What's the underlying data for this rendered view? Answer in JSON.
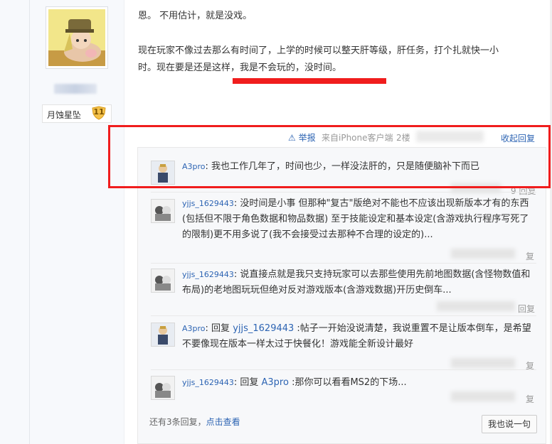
{
  "author": {
    "badge_name": "月蚀星坠",
    "badge_level": "11"
  },
  "post": {
    "line1": "恩。 不用估计，就是没戏。",
    "line2a": "现在玩家不像过去那么有时间了，上学的时候可以整天肝等级，肝任务，打个扎就快一小",
    "line2b": "时。现在要是还是这样，我是不会玩的，没时间。"
  },
  "meta": {
    "report": "举报",
    "from_device": "来自iPhone客户端",
    "floor": "2楼",
    "collapse": "收起回复"
  },
  "replies": [
    {
      "user": "A3pro",
      "sep": ": ",
      "text": "我也工作几年了，时间也少，一样没法肝的，只是随便脑补下而已",
      "foot": "9 回复"
    },
    {
      "user": "yjjs_1629443",
      "sep": ": ",
      "text": "没时间是小事 但那种\"复古\"版绝对不能也不应该出现新版本才有的东西(包括但不限于角色数据和物品数据) 至于技能设定和基本设定(含游戏执行程序写死了的限制)更不用多说了(我不会接受过去那种不合理的设定的)...",
      "foot": "复"
    },
    {
      "user": "yjjs_1629443",
      "sep": ": ",
      "text": "说直接点就是我只支持玩家可以去那些使用先前地图数据(含怪物数值和布局)的老地图玩玩但绝对反对游戏版本(含游戏数据)开历史倒车...",
      "foot": "回复"
    },
    {
      "user": "A3pro",
      "sep": ": ",
      "reply_word": "回复 ",
      "reply_to": "yjjs_1629443",
      "text": " :帖子一开始没说清楚，我说重置不是让版本倒车，是希望不要像现在版本一样太过于快餐化！游戏能全新设计最好",
      "foot": "复"
    },
    {
      "user": "yjjs_1629443",
      "sep": ": ",
      "reply_word": "回复 ",
      "reply_to": "A3pro",
      "text": " :那你可以看看MS2的下场...",
      "foot": "复"
    }
  ],
  "more": {
    "count_text": "还有3条回复，",
    "link": "点击查看"
  },
  "reply_button": "我也说一句",
  "colors": {
    "link": "#2d64b3",
    "highlight": "#f01d1d"
  }
}
